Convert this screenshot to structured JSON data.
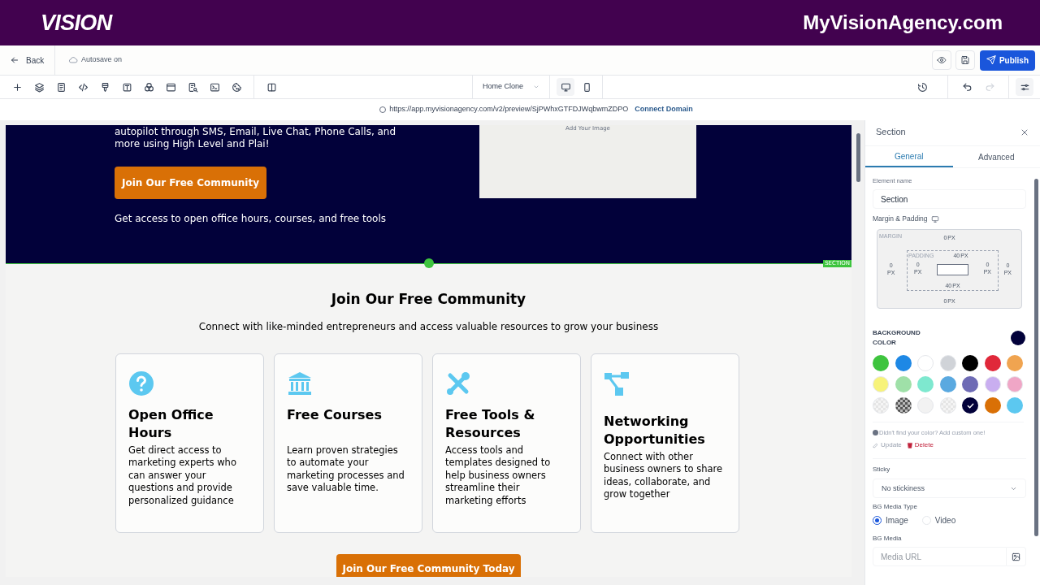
{
  "brand": {
    "logo": "VISION",
    "site": "MyVisionAgency.com"
  },
  "topbar": {
    "back": "Back",
    "autosave": "Autosave on",
    "publish": "Publish"
  },
  "toolbar": {
    "page": "Home Clone",
    "devices": [
      {
        "kind": "desktop",
        "selected": true
      },
      {
        "kind": "mobile",
        "selected": false
      }
    ]
  },
  "urlbar": {
    "url": "https://app.myvisionagency.com/v2/preview/SjPWhxGTFDJWqbwmZDPO",
    "link": "Connect Domain"
  },
  "hero": {
    "text": "autopilot through SMS, Email, Live Chat, Phone Calls, and more using High Level and Plai!",
    "button": "Join Our Free Community",
    "note": "Get access to open office hours, courses, and free tools",
    "image_label": "Add Your Image",
    "badge": "SECTION"
  },
  "community": {
    "title": "Join Our Free Community",
    "subtitle": "Connect with like-minded entrepreneurs and access valuable resources to grow your business",
    "cards": [
      {
        "kind": "question",
        "title": "Open Office Hours",
        "text": "Get direct access to marketing experts who can answer your questions and provide personalized guidance"
      },
      {
        "kind": "bank",
        "title": "Free Courses",
        "text": "Learn proven strategies to automate your marketing processes and save valuable time."
      },
      {
        "kind": "tools",
        "title": "Free Tools & Resources",
        "text": "Access tools and templates designed to help business owners streamline their marketing efforts"
      },
      {
        "kind": "network",
        "title": "Networking Opportunities",
        "text": "Connect with other business owners to share ideas, collaborate, and grow together"
      }
    ],
    "button": "Join Our Free Community Today"
  },
  "panel": {
    "title": "Section",
    "tabs": [
      {
        "label": "General",
        "selected": true
      },
      {
        "label": "Advanced",
        "selected": false
      }
    ],
    "element_name_label": "Element name",
    "element_name": "Section",
    "spacing_label": "Margin & Padding",
    "margin_label": "MARGIN",
    "padding_label": "PADDING",
    "margin": {
      "top": {
        "value": "0",
        "unit": "PX"
      },
      "right": {
        "value": "0",
        "unit": "PX"
      },
      "bottom": {
        "value": "0",
        "unit": "PX"
      },
      "left": {
        "value": "0",
        "unit": "PX"
      }
    },
    "padding": {
      "top": {
        "value": "40",
        "unit": "PX"
      },
      "right": {
        "value": "0",
        "unit": "PX"
      },
      "bottom": {
        "value": "40",
        "unit": "PX"
      },
      "left": {
        "value": "0",
        "unit": "PX"
      }
    },
    "bg_label": "BACKGROUND COLOR",
    "swatches": [
      {
        "kind": "solid",
        "color": "#3ec43e",
        "selected": false
      },
      {
        "kind": "solid",
        "color": "#1e88e5",
        "selected": false
      },
      {
        "kind": "solid",
        "color": "#ffffff",
        "selected": false
      },
      {
        "kind": "solid",
        "color": "#d0d3d8",
        "selected": false
      },
      {
        "kind": "solid",
        "color": "#000000",
        "selected": false
      },
      {
        "kind": "solid",
        "color": "#e0283a",
        "selected": false
      },
      {
        "kind": "solid",
        "color": "#f0a450",
        "selected": false
      },
      {
        "kind": "solid",
        "color": "#f7f37a",
        "selected": false
      },
      {
        "kind": "solid",
        "color": "#9fe0a8",
        "selected": false
      },
      {
        "kind": "solid",
        "color": "#7ee8cf",
        "selected": false
      },
      {
        "kind": "solid",
        "color": "#5aa9e0",
        "selected": false
      },
      {
        "kind": "solid",
        "color": "#6e6bb5",
        "selected": false
      },
      {
        "kind": "solid",
        "color": "#c9aef0",
        "selected": false
      },
      {
        "kind": "solid",
        "color": "#f0a6c6",
        "selected": false
      },
      {
        "kind": "checker",
        "color": "#e5e5e5",
        "selected": false
      },
      {
        "kind": "checker",
        "color": "#555555",
        "selected": false
      },
      {
        "kind": "solid",
        "color": "#f2f2f2",
        "selected": false
      },
      {
        "kind": "checker",
        "color": "#e5e5e5",
        "selected": false
      },
      {
        "kind": "solid",
        "color": "#02013a",
        "selected": true
      },
      {
        "kind": "solid",
        "color": "#d97006",
        "selected": false
      },
      {
        "kind": "solid",
        "color": "#5cc8f0",
        "selected": false
      }
    ],
    "hint": "Didn't find your color? Add custom one!",
    "update": "Update",
    "delete": "Delete",
    "sticky_label": "Sticky",
    "sticky": "No stickiness",
    "media_type_label": "BG Media Type",
    "media_types": [
      {
        "label": "Image",
        "selected": true
      },
      {
        "label": "Video",
        "selected": false
      }
    ],
    "media_label": "BG Media",
    "media_placeholder": "Media URL"
  }
}
